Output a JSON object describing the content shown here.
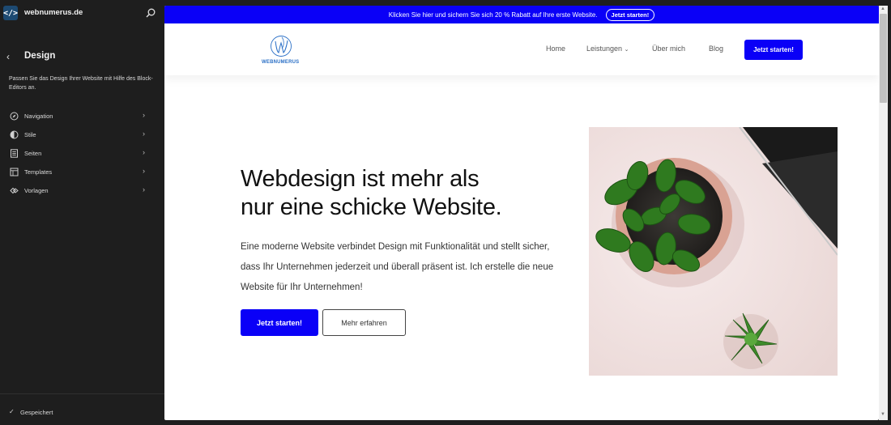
{
  "sidebar": {
    "logo_glyph": "</>",
    "site_name": "webnumerus.de",
    "section_title": "Design",
    "section_description": "Passen Sie das Design Ihrer Website mit Hilfe des Block-Editors an.",
    "items": [
      {
        "label": "Navigation",
        "icon": "navigation-icon"
      },
      {
        "label": "Stile",
        "icon": "styles-icon"
      },
      {
        "label": "Seiten",
        "icon": "pages-icon"
      },
      {
        "label": "Templates",
        "icon": "templates-icon"
      },
      {
        "label": "Vorlagen",
        "icon": "patterns-icon"
      }
    ],
    "status": "Gespeichert"
  },
  "site": {
    "promo": {
      "text": "Klicken Sie hier und sichern Sie sich 20 % Rabatt auf Ihre erste Website.",
      "button": "Jetzt starten!"
    },
    "logo_text": "WEBNUMERUS",
    "menu": {
      "home": "Home",
      "leistungen": "Leistungen",
      "ueber": "Über mich",
      "blog": "Blog"
    },
    "header_cta": "Jetzt starten!",
    "hero": {
      "title_line1": "Webdesign ist mehr als",
      "title_line2": "nur eine schicke Website.",
      "text": "Eine moderne Website verbindet Design mit Funktionalität und stellt sicher, dass Ihr Unternehmen jederzeit und überall präsent ist. Ich erstelle die neue Website für Ihr Unternehmen!",
      "primary_button": "Jetzt starten!",
      "secondary_button": "Mehr erfahren"
    }
  },
  "colors": {
    "brand_blue": "#0a00f7",
    "sidebar_bg": "#1e1e1e",
    "logo_blue": "#2a6fc6"
  }
}
